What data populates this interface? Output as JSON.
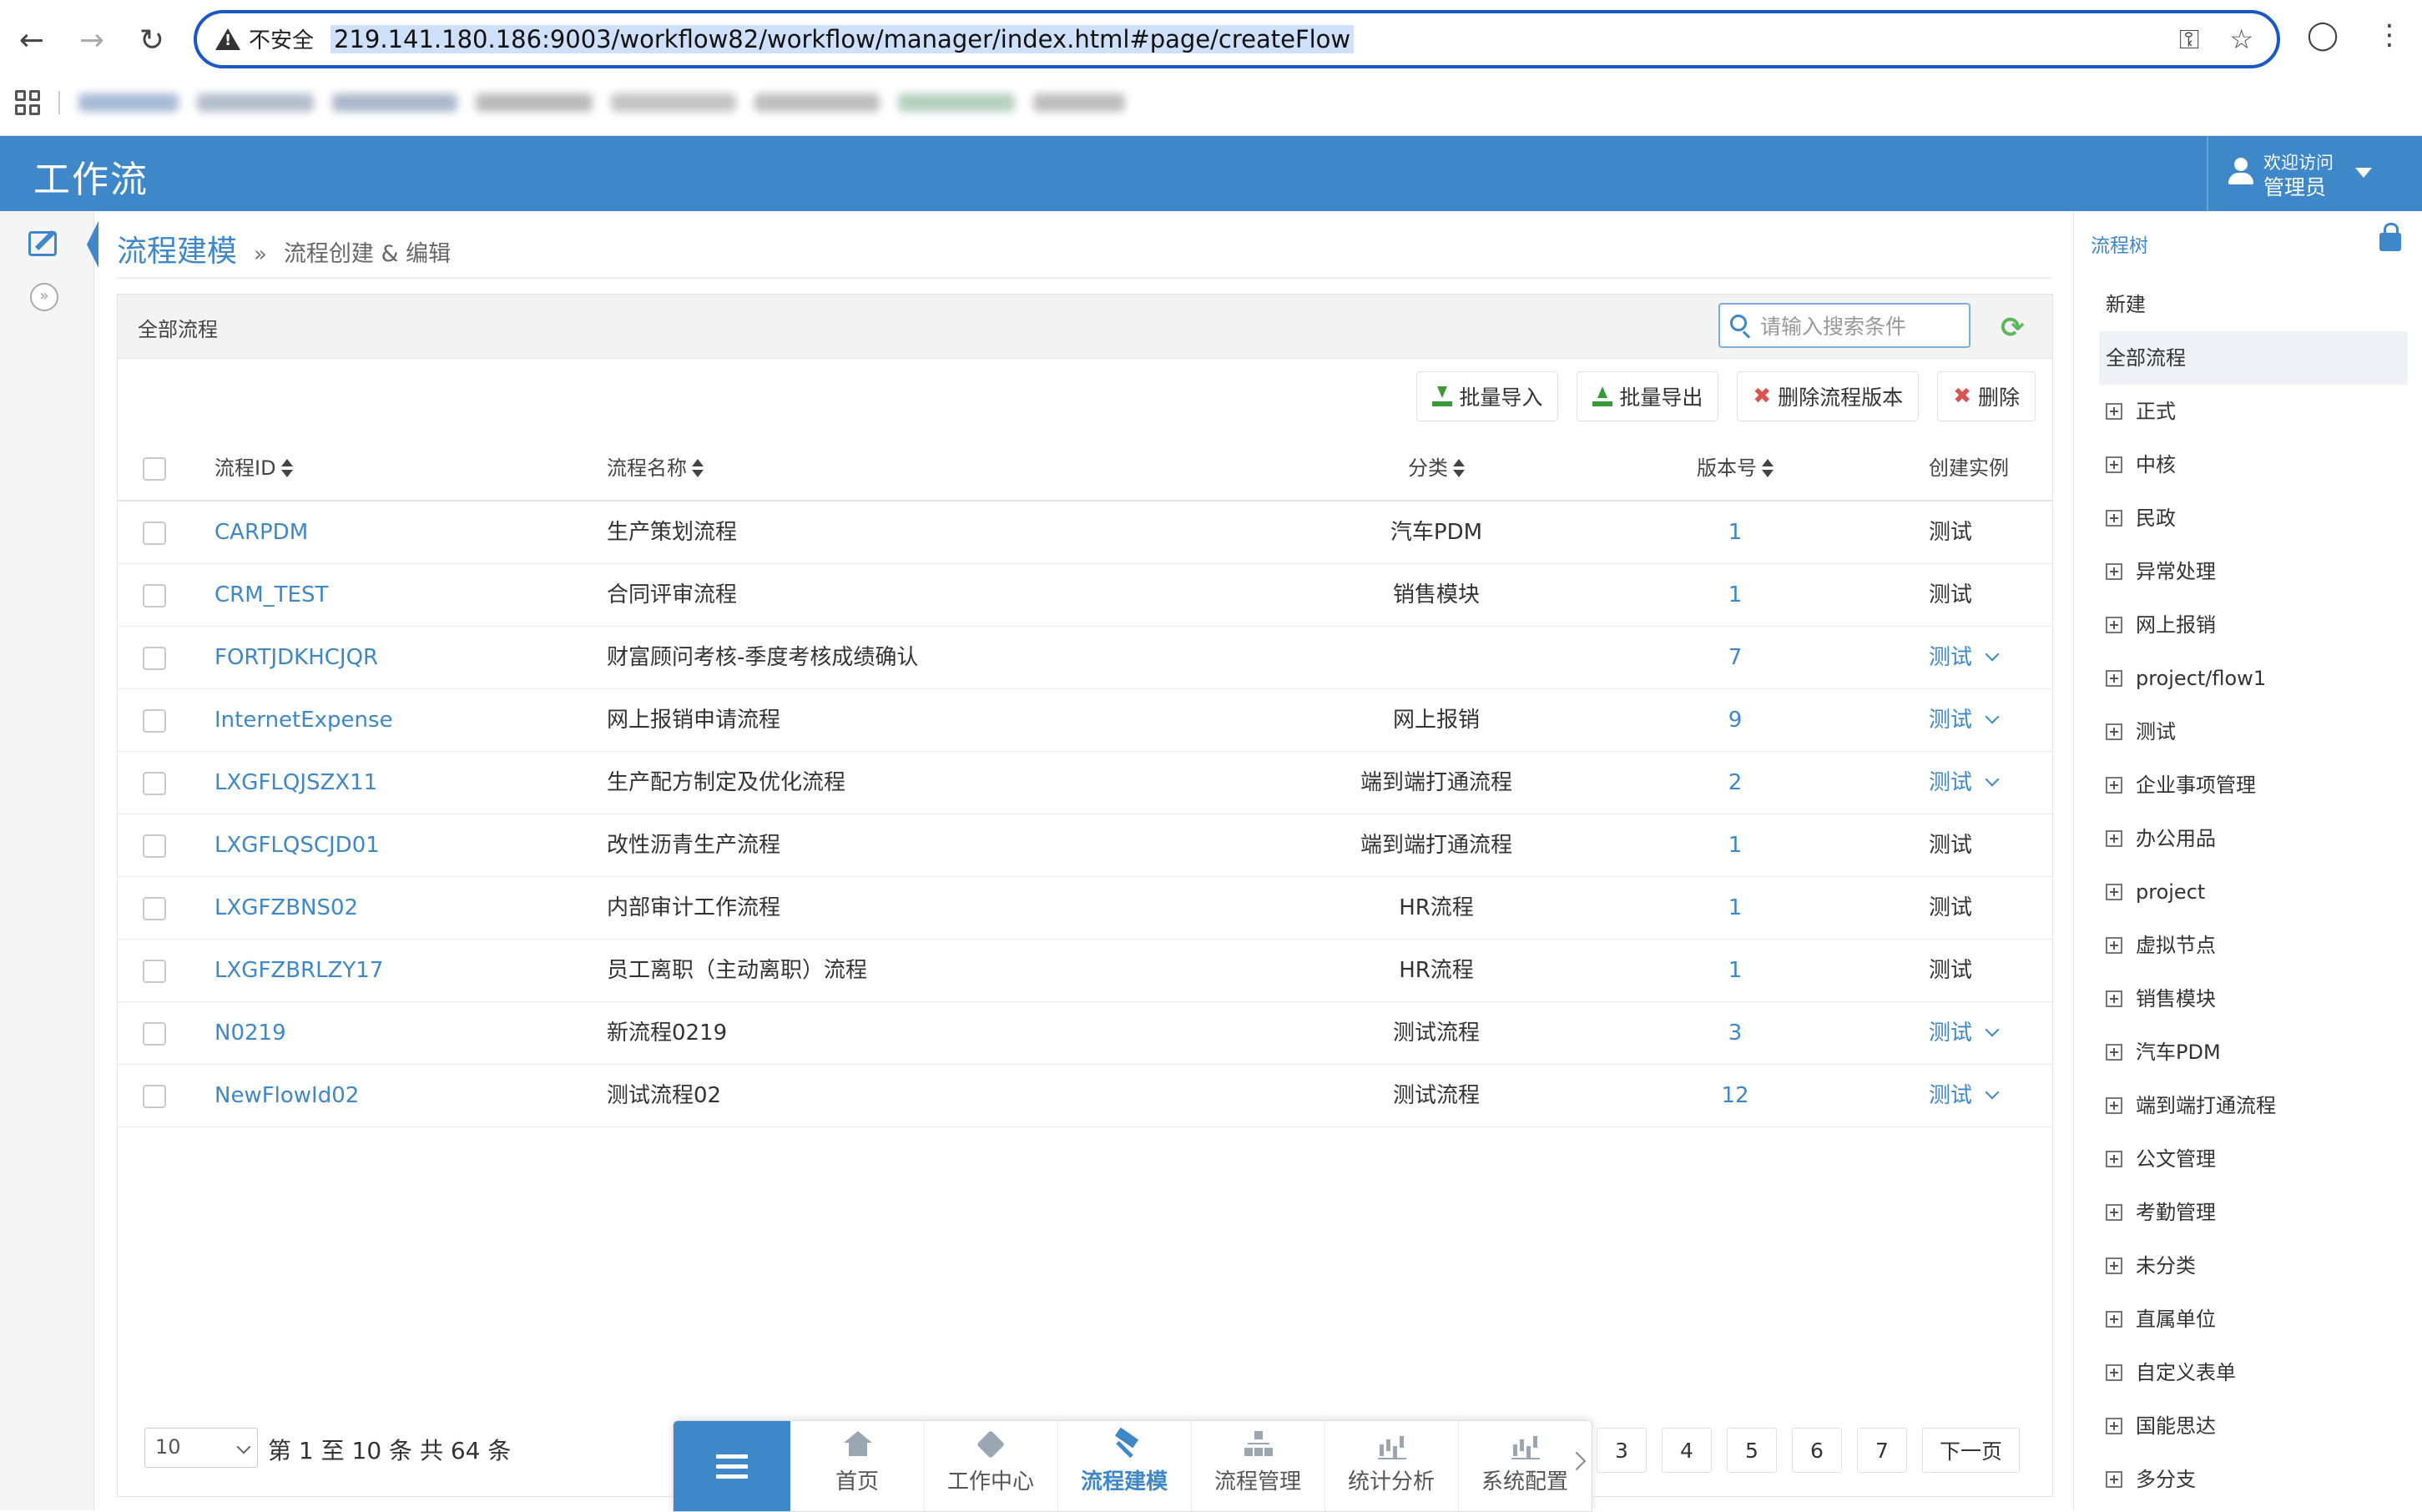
{
  "browser": {
    "security_label": "不安全",
    "url": "219.141.180.186:9003/workflow82/workflow/manager/index.html#page/createFlow"
  },
  "app": {
    "title": "工作流",
    "user_welcome": "欢迎访问",
    "user_name": "管理员"
  },
  "breadcrumb": {
    "main": "流程建模",
    "sep": "»",
    "sub": "流程创建 & 编辑"
  },
  "panel": {
    "title": "全部流程",
    "search_placeholder": "请输入搜索条件"
  },
  "toolbar": {
    "import_label": "批量导入",
    "export_label": "批量导出",
    "delete_version_label": "删除流程版本",
    "delete_label": "删除"
  },
  "table": {
    "headers": {
      "id": "流程ID",
      "name": "流程名称",
      "category": "分类",
      "version": "版本号",
      "action": "创建实例"
    },
    "rows": [
      {
        "id": "CARPDM",
        "name": "生产策划流程",
        "category": "汽车PDM",
        "version": "1",
        "action": "测试",
        "dropdown": false
      },
      {
        "id": "CRM_TEST",
        "name": "合同评审流程",
        "category": "销售模块",
        "version": "1",
        "action": "测试",
        "dropdown": false
      },
      {
        "id": "FORTJDKHCJQR",
        "name": "财富顾问考核-季度考核成绩确认",
        "category": "",
        "version": "7",
        "action": "测试",
        "dropdown": true
      },
      {
        "id": "InternetExpense",
        "name": "网上报销申请流程",
        "category": "网上报销",
        "version": "9",
        "action": "测试",
        "dropdown": true
      },
      {
        "id": "LXGFLQJSZX11",
        "name": "生产配方制定及优化流程",
        "category": "端到端打通流程",
        "version": "2",
        "action": "测试",
        "dropdown": true
      },
      {
        "id": "LXGFLQSCJD01",
        "name": "改性沥青生产流程",
        "category": "端到端打通流程",
        "version": "1",
        "action": "测试",
        "dropdown": false
      },
      {
        "id": "LXGFZBNS02",
        "name": "内部审计工作流程",
        "category": "HR流程",
        "version": "1",
        "action": "测试",
        "dropdown": false
      },
      {
        "id": "LXGFZBRLZY17",
        "name": "员工离职（主动离职）流程",
        "category": "HR流程",
        "version": "1",
        "action": "测试",
        "dropdown": false
      },
      {
        "id": "N0219",
        "name": "新流程0219",
        "category": "测试流程",
        "version": "3",
        "action": "测试",
        "dropdown": true
      },
      {
        "id": "NewFlowId02",
        "name": "测试流程02",
        "category": "测试流程",
        "version": "12",
        "action": "测试",
        "dropdown": true
      }
    ]
  },
  "footer": {
    "page_size": "10",
    "page_info": "第 1 至 10 条 共 64 条",
    "pages": [
      "3",
      "4",
      "5",
      "6",
      "7"
    ],
    "next_label": "下一页"
  },
  "dock": {
    "items": [
      {
        "label": "首页",
        "icon": "home-icon"
      },
      {
        "label": "工作中心",
        "icon": "tag-icon"
      },
      {
        "label": "流程建模",
        "icon": "hammer-icon"
      },
      {
        "label": "流程管理",
        "icon": "org-chart-icon"
      },
      {
        "label": "统计分析",
        "icon": "bar-chart-icon"
      },
      {
        "label": "系统配置",
        "icon": "bar-chart-icon"
      }
    ]
  },
  "tree": {
    "title": "流程树",
    "new_label": "新建",
    "all_label": "全部流程",
    "nodes": [
      "正式",
      "中核",
      "民政",
      "异常处理",
      "网上报销",
      "project/flow1",
      "测试",
      "企业事项管理",
      "办公用品",
      "project",
      "虚拟节点",
      "销售模块",
      "汽车PDM",
      "端到端打通流程",
      "公文管理",
      "考勤管理",
      "未分类",
      "直属单位",
      "自定义表单",
      "国能思达",
      "多分支"
    ]
  },
  "colors": {
    "primary": "#3e87c8",
    "success": "#5cb85c",
    "danger": "#d9534f"
  }
}
